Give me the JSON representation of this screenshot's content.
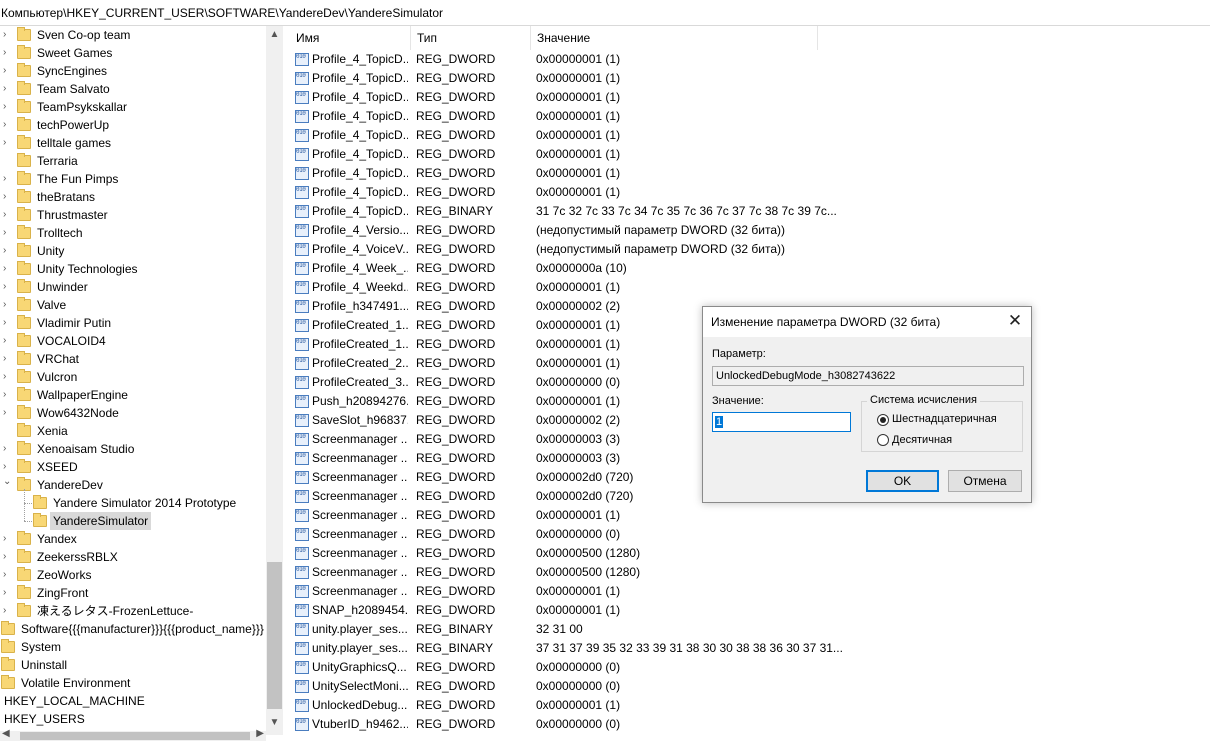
{
  "address_bar": {
    "path": "Компьютер\\HKEY_CURRENT_USER\\SOFTWARE\\YandereDev\\YandereSimulator"
  },
  "tree": {
    "items": [
      {
        "label": "Sven Co-op team",
        "expandable": true
      },
      {
        "label": "Sweet Games",
        "expandable": true
      },
      {
        "label": "SyncEngines",
        "expandable": true
      },
      {
        "label": "Team Salvato",
        "expandable": true
      },
      {
        "label": "TeamPsykskallar",
        "expandable": true
      },
      {
        "label": "techPowerUp",
        "expandable": true
      },
      {
        "label": "telltale games",
        "expandable": true
      },
      {
        "label": "Terraria",
        "expandable": false
      },
      {
        "label": "The Fun Pimps",
        "expandable": true
      },
      {
        "label": "theBratans",
        "expandable": true
      },
      {
        "label": "Thrustmaster",
        "expandable": true
      },
      {
        "label": "Trolltech",
        "expandable": true
      },
      {
        "label": "Unity",
        "expandable": true
      },
      {
        "label": "Unity Technologies",
        "expandable": true
      },
      {
        "label": "Unwinder",
        "expandable": true
      },
      {
        "label": "Valve",
        "expandable": true
      },
      {
        "label": "Vladimir Putin",
        "expandable": true
      },
      {
        "label": "VOCALOID4",
        "expandable": true
      },
      {
        "label": "VRChat",
        "expandable": true
      },
      {
        "label": "Vulcron",
        "expandable": true
      },
      {
        "label": "WallpaperEngine",
        "expandable": true
      },
      {
        "label": "Wow6432Node",
        "expandable": true
      },
      {
        "label": "Xenia",
        "expandable": false
      },
      {
        "label": "Xenoaisam Studio",
        "expandable": true
      },
      {
        "label": "XSEED",
        "expandable": true
      },
      {
        "label": "YandereDev",
        "expandable": true,
        "expanded": true
      }
    ],
    "children": [
      {
        "label": "Yandere Simulator 2014 Prototype"
      },
      {
        "label": "YandereSimulator",
        "selected": true
      }
    ],
    "after_items": [
      {
        "label": "Yandex",
        "expandable": true
      },
      {
        "label": "ZeekerssRBLX",
        "expandable": true
      },
      {
        "label": "ZeoWorks",
        "expandable": true
      },
      {
        "label": "ZingFront",
        "expandable": true
      },
      {
        "label": "凍えるレタス-FrozenLettuce-",
        "expandable": true
      }
    ],
    "top_level": [
      {
        "label": "Software{{{manufacturer}}}{{{product_name}}}"
      },
      {
        "label": "System",
        "expandable": true
      },
      {
        "label": "Uninstall"
      },
      {
        "label": "Volatile Environment"
      }
    ],
    "hives": [
      {
        "label": "HKEY_LOCAL_MACHINE"
      },
      {
        "label": "HKEY_USERS"
      }
    ],
    "scroll": {
      "position": 0.8
    }
  },
  "list": {
    "headers": {
      "name": "Имя",
      "type": "Тип",
      "value": "Значение"
    },
    "rows": [
      {
        "name": "Profile_4_TopicD...",
        "type": "REG_DWORD",
        "value": "0x00000001 (1)"
      },
      {
        "name": "Profile_4_TopicD...",
        "type": "REG_DWORD",
        "value": "0x00000001 (1)"
      },
      {
        "name": "Profile_4_TopicD...",
        "type": "REG_DWORD",
        "value": "0x00000001 (1)"
      },
      {
        "name": "Profile_4_TopicD...",
        "type": "REG_DWORD",
        "value": "0x00000001 (1)"
      },
      {
        "name": "Profile_4_TopicD...",
        "type": "REG_DWORD",
        "value": "0x00000001 (1)"
      },
      {
        "name": "Profile_4_TopicD...",
        "type": "REG_DWORD",
        "value": "0x00000001 (1)"
      },
      {
        "name": "Profile_4_TopicD...",
        "type": "REG_DWORD",
        "value": "0x00000001 (1)"
      },
      {
        "name": "Profile_4_TopicD...",
        "type": "REG_DWORD",
        "value": "0x00000001 (1)"
      },
      {
        "name": "Profile_4_TopicD...",
        "type": "REG_BINARY",
        "value": "31 7c 32 7c 33 7c 34 7c 35 7c 36 7c 37 7c 38 7c 39 7c..."
      },
      {
        "name": "Profile_4_Versio...",
        "type": "REG_DWORD",
        "value": "(недопустимый параметр DWORD (32 бита))"
      },
      {
        "name": "Profile_4_VoiceV...",
        "type": "REG_DWORD",
        "value": "(недопустимый параметр DWORD (32 бита))"
      },
      {
        "name": "Profile_4_Week_...",
        "type": "REG_DWORD",
        "value": "0x0000000a (10)"
      },
      {
        "name": "Profile_4_Weekd...",
        "type": "REG_DWORD",
        "value": "0x00000001 (1)"
      },
      {
        "name": "Profile_h347491...",
        "type": "REG_DWORD",
        "value": "0x00000002 (2)"
      },
      {
        "name": "ProfileCreated_1...",
        "type": "REG_DWORD",
        "value": "0x00000001 (1)"
      },
      {
        "name": "ProfileCreated_1...",
        "type": "REG_DWORD",
        "value": "0x00000001 (1)"
      },
      {
        "name": "ProfileCreated_2...",
        "type": "REG_DWORD",
        "value": "0x00000001 (1)"
      },
      {
        "name": "ProfileCreated_3...",
        "type": "REG_DWORD",
        "value": "0x00000000 (0)"
      },
      {
        "name": "Push_h20894276...",
        "type": "REG_DWORD",
        "value": "0x00000001 (1)"
      },
      {
        "name": "SaveSlot_h96837...",
        "type": "REG_DWORD",
        "value": "0x00000002 (2)"
      },
      {
        "name": "Screenmanager ...",
        "type": "REG_DWORD",
        "value": "0x00000003 (3)"
      },
      {
        "name": "Screenmanager ...",
        "type": "REG_DWORD",
        "value": "0x00000003 (3)"
      },
      {
        "name": "Screenmanager ...",
        "type": "REG_DWORD",
        "value": "0x000002d0 (720)"
      },
      {
        "name": "Screenmanager ...",
        "type": "REG_DWORD",
        "value": "0x000002d0 (720)"
      },
      {
        "name": "Screenmanager ...",
        "type": "REG_DWORD",
        "value": "0x00000001 (1)"
      },
      {
        "name": "Screenmanager ...",
        "type": "REG_DWORD",
        "value": "0x00000000 (0)"
      },
      {
        "name": "Screenmanager ...",
        "type": "REG_DWORD",
        "value": "0x00000500 (1280)"
      },
      {
        "name": "Screenmanager ...",
        "type": "REG_DWORD",
        "value": "0x00000500 (1280)"
      },
      {
        "name": "Screenmanager ...",
        "type": "REG_DWORD",
        "value": "0x00000001 (1)"
      },
      {
        "name": "SNAP_h2089454...",
        "type": "REG_DWORD",
        "value": "0x00000001 (1)"
      },
      {
        "name": "unity.player_ses...",
        "type": "REG_BINARY",
        "value": "32 31 00"
      },
      {
        "name": "unity.player_ses...",
        "type": "REG_BINARY",
        "value": "37 31 37 39 35 32 33 39 31 38 30 30 38 38 36 30 37 31..."
      },
      {
        "name": "UnityGraphicsQ...",
        "type": "REG_DWORD",
        "value": "0x00000000 (0)"
      },
      {
        "name": "UnitySelectMoni...",
        "type": "REG_DWORD",
        "value": "0x00000000 (0)"
      },
      {
        "name": "UnlockedDebug...",
        "type": "REG_DWORD",
        "value": "0x00000001 (1)"
      },
      {
        "name": "VtuberID_h9462...",
        "type": "REG_DWORD",
        "value": "0x00000000 (0)"
      }
    ]
  },
  "dialog": {
    "title": "Изменение параметра DWORD (32 бита)",
    "param_label": "Параметр:",
    "param_value": "UnlockedDebugMode_h3082743622",
    "value_label": "Значение:",
    "value": "1",
    "base_group_title": "Система исчисления",
    "base_hex_label": "Шестнадцатеричная",
    "base_dec_label": "Десятичная",
    "selected_base": "hex",
    "ok_label": "OK",
    "cancel_label": "Отмена"
  }
}
